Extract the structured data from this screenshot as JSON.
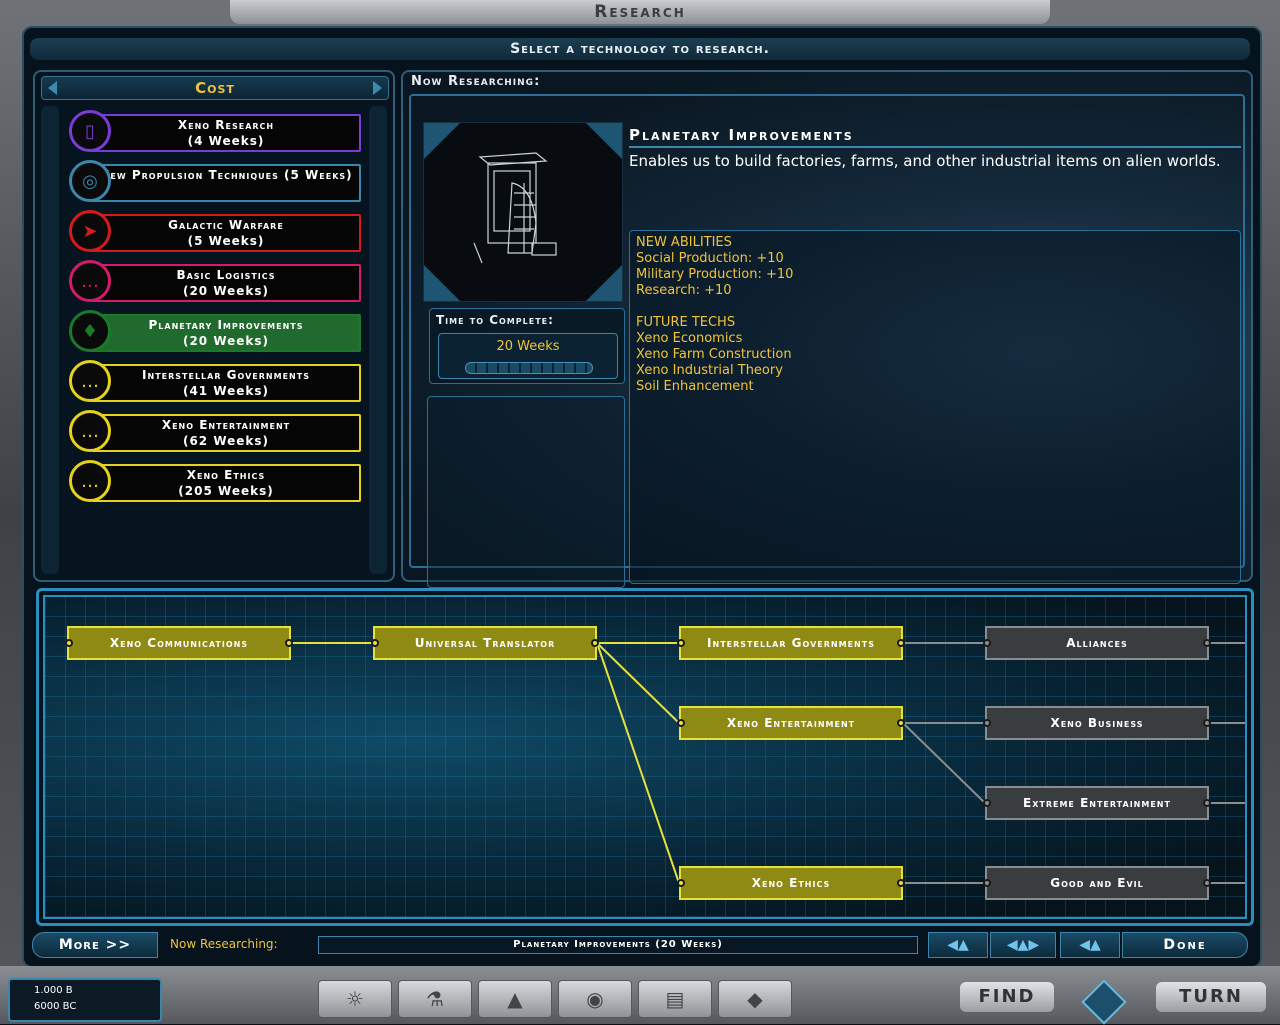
{
  "window": {
    "title": "Research"
  },
  "instruction": "Select a technology to research.",
  "left_panel": {
    "header": "Cost",
    "techs": [
      {
        "name": "Xeno Research",
        "weeks": "(4 Weeks)",
        "color": "#7b3cd6"
      },
      {
        "name": "New Propulsion Techniques (5 Weeks)",
        "weeks": "",
        "color": "#3b86ad"
      },
      {
        "name": "Galactic Warfare",
        "weeks": "(5 Weeks)",
        "color": "#d41a1a"
      },
      {
        "name": "Basic Logistics",
        "weeks": "(20 Weeks)",
        "color": "#d41a6a"
      },
      {
        "name": "Planetary Improvements",
        "weeks": "(20 Weeks)",
        "color": "#1a7a2a"
      },
      {
        "name": "Interstellar Governments",
        "weeks": "(41 Weeks)",
        "color": "#e6d21a"
      },
      {
        "name": "Xeno Entertainment",
        "weeks": "(62 Weeks)",
        "color": "#e6d21a"
      },
      {
        "name": "Xeno Ethics",
        "weeks": "(205 Weeks)",
        "color": "#e6d21a"
      }
    ]
  },
  "right_panel": {
    "now_researching_label": "Now Researching:",
    "tech_title": "Planetary Improvements",
    "tech_description": "Enables us to build factories, farms, and other industrial items on alien worlds.",
    "time_to_complete_label": "Time to Complete:",
    "time_to_complete_value": "20 Weeks",
    "info": {
      "new_abilities_header": "NEW ABILITIES",
      "abilities": [
        "Social Production: +10",
        "Military Production: +10",
        "Research: +10"
      ],
      "future_techs_header": "FUTURE TECHS",
      "future_techs": [
        "Xeno Economics",
        "Xeno Farm Construction",
        "Xeno Industrial Theory",
        "Soil Enhancement"
      ]
    }
  },
  "tree": {
    "nodes": [
      {
        "id": "xeno-communications",
        "label": "Xeno Communications",
        "state": "known"
      },
      {
        "id": "universal-translator",
        "label": "Universal Translator",
        "state": "known"
      },
      {
        "id": "interstellar-governments",
        "label": "Interstellar Governments",
        "state": "available"
      },
      {
        "id": "alliances",
        "label": "Alliances",
        "state": "locked"
      },
      {
        "id": "xeno-entertainment",
        "label": "Xeno Entertainment",
        "state": "available"
      },
      {
        "id": "xeno-business",
        "label": "Xeno Business",
        "state": "locked"
      },
      {
        "id": "extreme-entertainment",
        "label": "Extreme Entertainment",
        "state": "locked"
      },
      {
        "id": "xeno-ethics",
        "label": "Xeno Ethics",
        "state": "available"
      },
      {
        "id": "good-and-evil",
        "label": "Good and Evil",
        "state": "locked"
      }
    ]
  },
  "bottom_bar": {
    "more_label": "More >>",
    "now_researching_label": "Now Researching:",
    "status_value": "Planetary Improvements (20 Weeks)",
    "done_label": "Done"
  },
  "footer": {
    "population": "1.000 B",
    "credits": "6000 BC",
    "find_label": "FIND",
    "turn_label": "TURN"
  },
  "colors": {
    "accent_yellow": "#f0c33b",
    "frame_blue": "#2a8fc0"
  }
}
